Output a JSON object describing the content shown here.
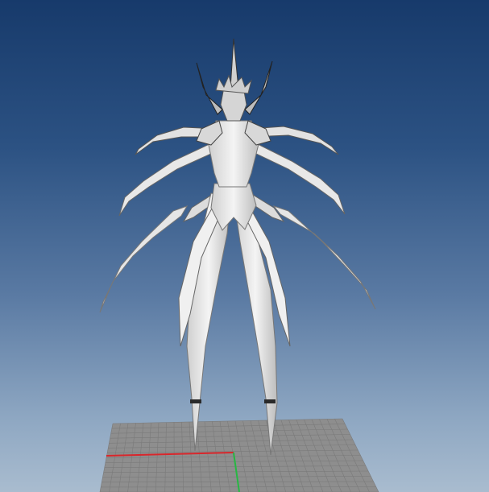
{
  "viewport": {
    "background_top": "#173a6b",
    "background_bottom": "#a9bccf"
  },
  "ground_grid": {
    "fill": "#8e8e8e",
    "line_color": "#7a7a7a"
  },
  "axes": {
    "x_axis_color": "#d9262b",
    "y_axis_color": "#27b843"
  },
  "model": {
    "body_color": "#f2f2f2",
    "shadow_color": "#9a9a9a",
    "dark_color": "#2a2a2a"
  }
}
